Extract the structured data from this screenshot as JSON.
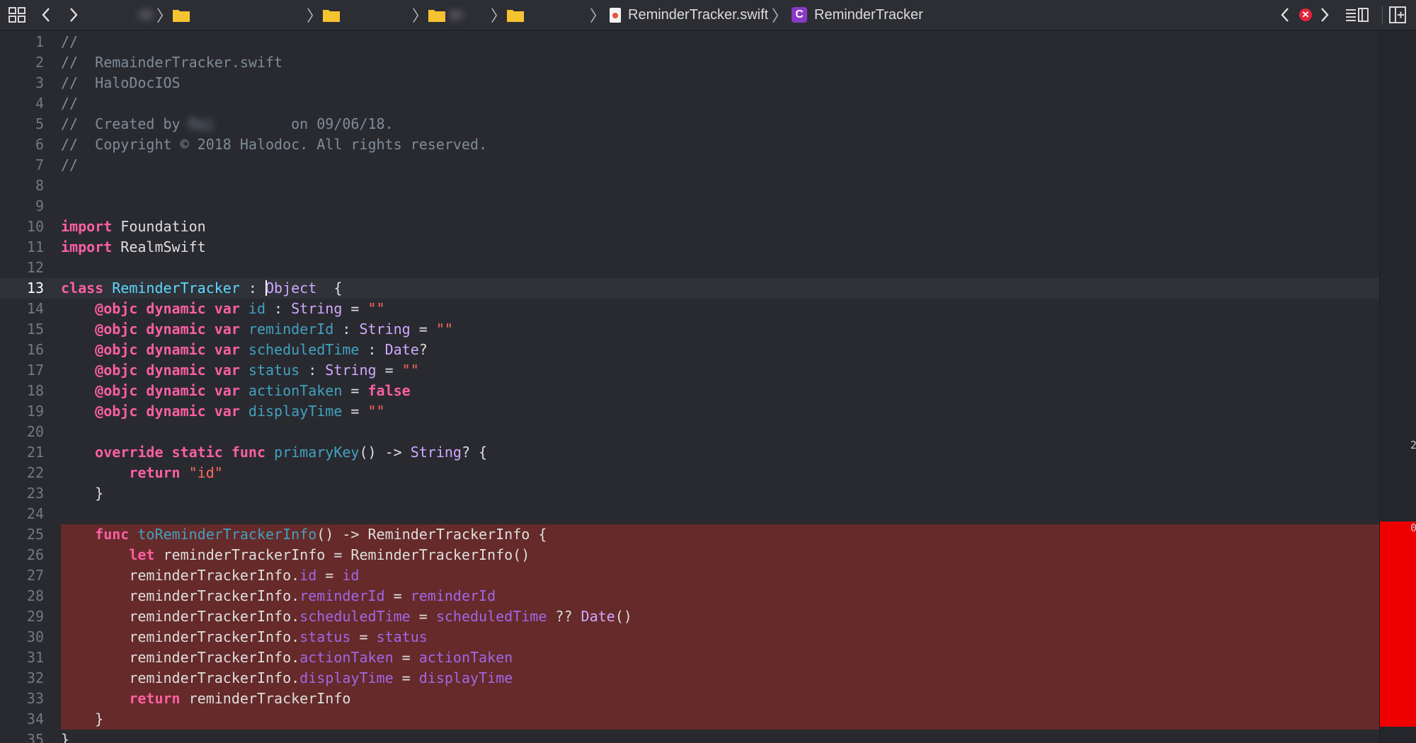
{
  "jumpbar": {
    "file_name": "ReminderTracker.swift",
    "class_name": "ReminderTracker",
    "class_badge": "C",
    "error_badge": "✕",
    "separator": "〉"
  },
  "gutter": {
    "marker_top": "2",
    "marker_error": "0"
  },
  "editor": {
    "current_line": 13,
    "lines": [
      {
        "n": "1",
        "tokens": [
          {
            "t": "//",
            "c": "comment"
          }
        ]
      },
      {
        "n": "2",
        "tokens": [
          {
            "t": "//  RemainderTracker.swift",
            "c": "comment"
          }
        ]
      },
      {
        "n": "3",
        "tokens": [
          {
            "t": "//  HaloDocIOS",
            "c": "comment"
          }
        ]
      },
      {
        "n": "4",
        "tokens": [
          {
            "t": "//",
            "c": "comment"
          }
        ]
      },
      {
        "n": "5",
        "tokens": [
          {
            "t": "//  Created by ",
            "c": "comment"
          },
          {
            "t": "Raj",
            "c": "redacted"
          },
          {
            "t": "         on 09/06/18.",
            "c": "comment"
          }
        ]
      },
      {
        "n": "6",
        "tokens": [
          {
            "t": "//  Copyright © 2018 Halodoc. All rights reserved.",
            "c": "comment"
          }
        ]
      },
      {
        "n": "7",
        "tokens": [
          {
            "t": "//",
            "c": "comment"
          }
        ]
      },
      {
        "n": "8",
        "tokens": []
      },
      {
        "n": "9",
        "tokens": []
      },
      {
        "n": "10",
        "tokens": [
          {
            "t": "import",
            "c": "kw"
          },
          {
            "t": " Foundation",
            "c": "plain"
          }
        ]
      },
      {
        "n": "11",
        "tokens": [
          {
            "t": "import",
            "c": "kw"
          },
          {
            "t": " RealmSwift",
            "c": "plain"
          }
        ]
      },
      {
        "n": "12",
        "tokens": []
      },
      {
        "n": "13",
        "tokens": [
          {
            "t": "class",
            "c": "kw"
          },
          {
            "t": " ",
            "c": "plain"
          },
          {
            "t": "ReminderTracker",
            "c": "typename"
          },
          {
            "t": " : ",
            "c": "plain"
          },
          {
            "t": "",
            "c": "cursor"
          },
          {
            "t": "Object",
            "c": "type"
          },
          {
            "t": "  {",
            "c": "plain"
          }
        ]
      },
      {
        "n": "14",
        "tokens": [
          {
            "t": "    ",
            "c": "plain"
          },
          {
            "t": "@objc dynamic var",
            "c": "kw"
          },
          {
            "t": " ",
            "c": "plain"
          },
          {
            "t": "id",
            "c": "decl"
          },
          {
            "t": " : ",
            "c": "plain"
          },
          {
            "t": "String",
            "c": "type"
          },
          {
            "t": " = ",
            "c": "plain"
          },
          {
            "t": "\"\"",
            "c": "string"
          }
        ]
      },
      {
        "n": "15",
        "tokens": [
          {
            "t": "    ",
            "c": "plain"
          },
          {
            "t": "@objc dynamic var",
            "c": "kw"
          },
          {
            "t": " ",
            "c": "plain"
          },
          {
            "t": "reminderId",
            "c": "decl"
          },
          {
            "t": " : ",
            "c": "plain"
          },
          {
            "t": "String",
            "c": "type"
          },
          {
            "t": " = ",
            "c": "plain"
          },
          {
            "t": "\"\"",
            "c": "string"
          }
        ]
      },
      {
        "n": "16",
        "tokens": [
          {
            "t": "    ",
            "c": "plain"
          },
          {
            "t": "@objc dynamic var",
            "c": "kw"
          },
          {
            "t": " ",
            "c": "plain"
          },
          {
            "t": "scheduledTime",
            "c": "decl"
          },
          {
            "t": " : ",
            "c": "plain"
          },
          {
            "t": "Date",
            "c": "type"
          },
          {
            "t": "?",
            "c": "plain"
          }
        ]
      },
      {
        "n": "17",
        "tokens": [
          {
            "t": "    ",
            "c": "plain"
          },
          {
            "t": "@objc dynamic var",
            "c": "kw"
          },
          {
            "t": " ",
            "c": "plain"
          },
          {
            "t": "status",
            "c": "decl"
          },
          {
            "t": " : ",
            "c": "plain"
          },
          {
            "t": "String",
            "c": "type"
          },
          {
            "t": " = ",
            "c": "plain"
          },
          {
            "t": "\"\"",
            "c": "string"
          }
        ]
      },
      {
        "n": "18",
        "tokens": [
          {
            "t": "    ",
            "c": "plain"
          },
          {
            "t": "@objc dynamic var",
            "c": "kw"
          },
          {
            "t": " ",
            "c": "plain"
          },
          {
            "t": "actionTaken",
            "c": "decl"
          },
          {
            "t": " = ",
            "c": "plain"
          },
          {
            "t": "false",
            "c": "kw"
          }
        ]
      },
      {
        "n": "19",
        "tokens": [
          {
            "t": "    ",
            "c": "plain"
          },
          {
            "t": "@objc dynamic var",
            "c": "kw"
          },
          {
            "t": " ",
            "c": "plain"
          },
          {
            "t": "displayTime",
            "c": "decl"
          },
          {
            "t": " = ",
            "c": "plain"
          },
          {
            "t": "\"\"",
            "c": "string"
          }
        ]
      },
      {
        "n": "20",
        "tokens": []
      },
      {
        "n": "21",
        "tokens": [
          {
            "t": "    ",
            "c": "plain"
          },
          {
            "t": "override static func",
            "c": "kw"
          },
          {
            "t": " ",
            "c": "plain"
          },
          {
            "t": "primaryKey",
            "c": "decl"
          },
          {
            "t": "() -> ",
            "c": "plain"
          },
          {
            "t": "String",
            "c": "type"
          },
          {
            "t": "? {",
            "c": "plain"
          }
        ]
      },
      {
        "n": "22",
        "tokens": [
          {
            "t": "        ",
            "c": "plain"
          },
          {
            "t": "return",
            "c": "kw"
          },
          {
            "t": " ",
            "c": "plain"
          },
          {
            "t": "\"id\"",
            "c": "string"
          }
        ]
      },
      {
        "n": "23",
        "tokens": [
          {
            "t": "    }",
            "c": "plain"
          }
        ]
      },
      {
        "n": "24",
        "tokens": []
      },
      {
        "n": "25",
        "error": true,
        "tokens": [
          {
            "t": "    ",
            "c": "plain"
          },
          {
            "t": "func",
            "c": "kw"
          },
          {
            "t": " ",
            "c": "plain"
          },
          {
            "t": "toReminderTrackerInfo",
            "c": "decl"
          },
          {
            "t": "() -> ReminderTrackerInfo {",
            "c": "plain"
          }
        ]
      },
      {
        "n": "26",
        "error": true,
        "tokens": [
          {
            "t": "        ",
            "c": "plain"
          },
          {
            "t": "let",
            "c": "kw"
          },
          {
            "t": " reminderTrackerInfo = ReminderTrackerInfo()",
            "c": "plain"
          }
        ]
      },
      {
        "n": "27",
        "error": true,
        "tokens": [
          {
            "t": "        reminderTrackerInfo.",
            "c": "plain"
          },
          {
            "t": "id",
            "c": "member"
          },
          {
            "t": " = ",
            "c": "plain"
          },
          {
            "t": "id",
            "c": "member"
          }
        ]
      },
      {
        "n": "28",
        "error": true,
        "tokens": [
          {
            "t": "        reminderTrackerInfo.",
            "c": "plain"
          },
          {
            "t": "reminderId",
            "c": "member"
          },
          {
            "t": " = ",
            "c": "plain"
          },
          {
            "t": "reminderId",
            "c": "member"
          }
        ]
      },
      {
        "n": "29",
        "error": true,
        "tokens": [
          {
            "t": "        reminderTrackerInfo.",
            "c": "plain"
          },
          {
            "t": "scheduledTime",
            "c": "member"
          },
          {
            "t": " = ",
            "c": "plain"
          },
          {
            "t": "scheduledTime",
            "c": "member"
          },
          {
            "t": " ?? ",
            "c": "plain"
          },
          {
            "t": "Date",
            "c": "type"
          },
          {
            "t": "()",
            "c": "plain"
          }
        ]
      },
      {
        "n": "30",
        "error": true,
        "tokens": [
          {
            "t": "        reminderTrackerInfo.",
            "c": "plain"
          },
          {
            "t": "status",
            "c": "member"
          },
          {
            "t": " = ",
            "c": "plain"
          },
          {
            "t": "status",
            "c": "member"
          }
        ]
      },
      {
        "n": "31",
        "error": true,
        "tokens": [
          {
            "t": "        reminderTrackerInfo.",
            "c": "plain"
          },
          {
            "t": "actionTaken",
            "c": "member"
          },
          {
            "t": " = ",
            "c": "plain"
          },
          {
            "t": "actionTaken",
            "c": "member"
          }
        ]
      },
      {
        "n": "32",
        "error": true,
        "tokens": [
          {
            "t": "        reminderTrackerInfo.",
            "c": "plain"
          },
          {
            "t": "displayTime",
            "c": "member"
          },
          {
            "t": " = ",
            "c": "plain"
          },
          {
            "t": "displayTime",
            "c": "member"
          }
        ]
      },
      {
        "n": "33",
        "error": true,
        "tokens": [
          {
            "t": "        ",
            "c": "plain"
          },
          {
            "t": "return",
            "c": "kw"
          },
          {
            "t": " reminderTrackerInfo",
            "c": "plain"
          }
        ]
      },
      {
        "n": "34",
        "error": true,
        "tokens": [
          {
            "t": "    }",
            "c": "plain"
          }
        ]
      },
      {
        "n": "35",
        "tokens": [
          {
            "t": "}",
            "c": "plain"
          }
        ]
      }
    ]
  }
}
